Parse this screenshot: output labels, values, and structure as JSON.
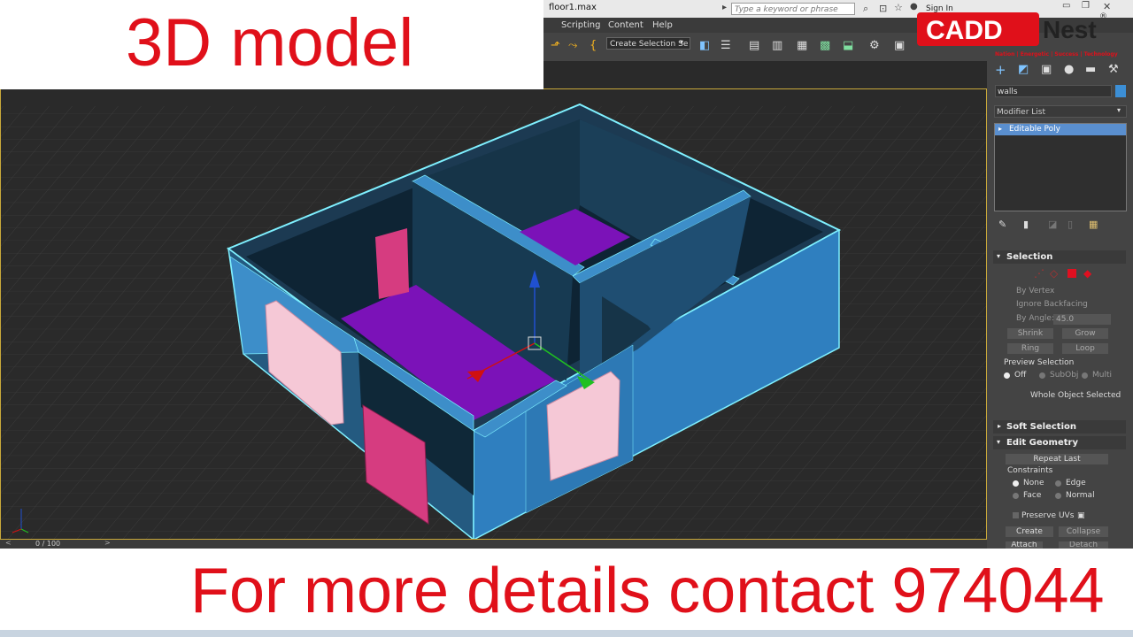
{
  "header": {
    "title": "3D model"
  },
  "window": {
    "file_name": "floor1.max",
    "search_placeholder": "Type a keyword or phrase",
    "sign_in": "Sign In"
  },
  "menu": [
    "Scripting",
    "Content",
    "Help"
  ],
  "toolbar": {
    "selection_set": "Create Selection Se"
  },
  "logo": {
    "brand": "CADD",
    "brand2": "Nest",
    "registered": "®",
    "tagline": "Nation | Energetic | Success | Technology"
  },
  "command_panel": {
    "object_name": "walls",
    "object_color": "#3c8fd6",
    "modifier_list": "Modifier List",
    "stack_item": "Editable Poly",
    "selection": {
      "title": "Selection",
      "by_vertex": "By Vertex",
      "ignore_backfacing": "Ignore Backfacing",
      "by_angle": "By Angle:",
      "angle_value": "45.0",
      "shrink": "Shrink",
      "grow": "Grow",
      "ring": "Ring",
      "loop": "Loop",
      "preview_selection": "Preview Selection",
      "preview_options": [
        "Off",
        "SubObj",
        "Multi"
      ],
      "preview_selected": "Off",
      "status": "Whole Object Selected"
    },
    "soft_selection": {
      "title": "Soft Selection"
    },
    "edit_geometry": {
      "title": "Edit Geometry",
      "repeat_last": "Repeat Last",
      "constraints": "Constraints",
      "constraint_options": [
        "None",
        "Edge",
        "Face",
        "Normal"
      ],
      "constraint_selected": "None",
      "preserve_uvs": "Preserve UVs",
      "create": "Create",
      "collapse": "Collapse",
      "attach": "Attach",
      "detach": "Detach"
    }
  },
  "timeline": {
    "counter": "0 / 100"
  },
  "footer": {
    "text": "For more details contact 974044"
  },
  "colors": {
    "accent_red": "#e0101a",
    "wall_blue": "#2f7fbf",
    "floor_purple": "#7b12b8",
    "selection_outline": "#7ff0ff"
  }
}
